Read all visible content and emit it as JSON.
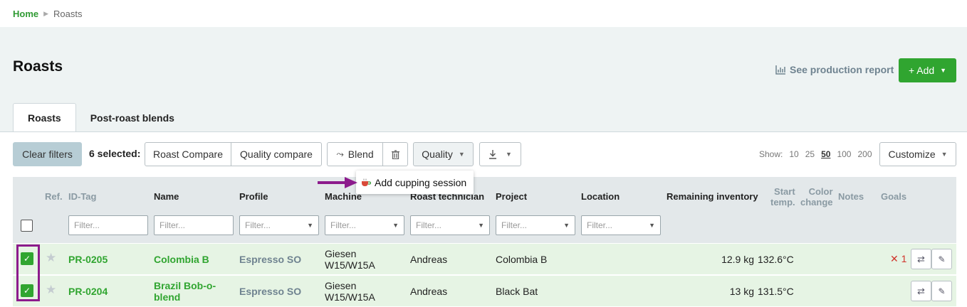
{
  "breadcrumb": {
    "home": "Home",
    "current": "Roasts"
  },
  "header": {
    "title": "Roasts",
    "report_link": "See production report",
    "add_label": "+ Add"
  },
  "tabs": [
    {
      "label": "Roasts",
      "active": true
    },
    {
      "label": "Post-roast blends",
      "active": false
    }
  ],
  "toolbar": {
    "clear_filters": "Clear filters",
    "selected_label": "6 selected:",
    "roast_compare": "Roast Compare",
    "quality_compare": "Quality compare",
    "blend": "Blend",
    "quality": "Quality",
    "show_label": "Show:",
    "page_sizes": [
      "10",
      "25",
      "50",
      "100",
      "200"
    ],
    "page_size_selected": "50",
    "customize": "Customize"
  },
  "popup": {
    "label": "Add cupping session"
  },
  "columns": {
    "ref": "Ref.",
    "id_tag": "ID-Tag",
    "name": "Name",
    "profile": "Profile",
    "machine": "Machine",
    "roast_technician": "Roast technician",
    "project": "Project",
    "location": "Location",
    "remaining_inventory": "Remaining inventory",
    "start_temp_1": "Start",
    "start_temp_2": "temp.",
    "color_change_1": "Color",
    "color_change_2": "change",
    "notes": "Notes",
    "goals": "Goals"
  },
  "filter_placeholder": "Filter...",
  "rows": [
    {
      "id_tag": "PR-0205",
      "name_1": "Colombia B",
      "name_2": "",
      "profile": "Espresso SO",
      "machine_1": "Giesen",
      "machine_2": "W15/W15A",
      "technician": "Andreas",
      "project": "Colombia B",
      "inventory": "12.9 kg",
      "start_temp": "132.6°C",
      "goals": "✕ 1"
    },
    {
      "id_tag": "PR-0204",
      "name_1": "Brazil Bob-o-",
      "name_2": "blend",
      "profile": "Espresso SO",
      "machine_1": "Giesen",
      "machine_2": "W15/W15A",
      "technician": "Andreas",
      "project": "Black Bat",
      "inventory": "13 kg",
      "start_temp": "131.5°C",
      "goals": ""
    }
  ],
  "colors": {
    "accent": "#30a530",
    "highlight": "#8c1b8c",
    "row_selected": "#e6f4e4"
  }
}
